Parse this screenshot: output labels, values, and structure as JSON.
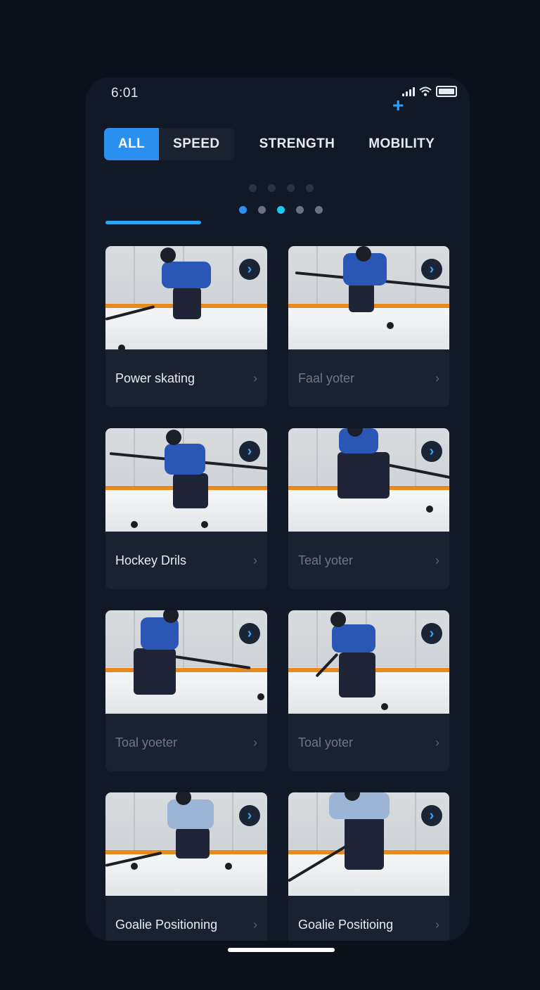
{
  "status_bar": {
    "time": "6:01"
  },
  "header": {
    "add_icon": "plus-icon"
  },
  "tabs": [
    {
      "label": "ALL",
      "active": true
    },
    {
      "label": "SPEED",
      "active": false
    },
    {
      "label": "STRENGTH",
      "active": false
    },
    {
      "label": "MOBILITY",
      "active": false
    }
  ],
  "carousel": {
    "active_index": 2,
    "count": 5
  },
  "cards": [
    {
      "title": "Power skating",
      "dim": false,
      "shirt": "#2a57b6"
    },
    {
      "title": "Faal yoter",
      "dim": true,
      "shirt": "#2a57b6"
    },
    {
      "title": "Hockey Drils",
      "dim": false,
      "shirt": "#2a57b6"
    },
    {
      "title": "Teal yoter",
      "dim": true,
      "shirt": "#2a57b6"
    },
    {
      "title": "Toal yoeter",
      "dim": true,
      "shirt": "#2a57b6"
    },
    {
      "title": "Toal yoter",
      "dim": true,
      "shirt": "#2a57b6"
    },
    {
      "title": "Goalie Positioning",
      "dim": false,
      "shirt": "#9cb5d6"
    },
    {
      "title": "Goalie Positioing",
      "dim": false,
      "shirt": "#9cb5d6"
    }
  ],
  "colors": {
    "accent": "#2b8ff0",
    "background": "#0b111b",
    "card": "#1a2130"
  }
}
